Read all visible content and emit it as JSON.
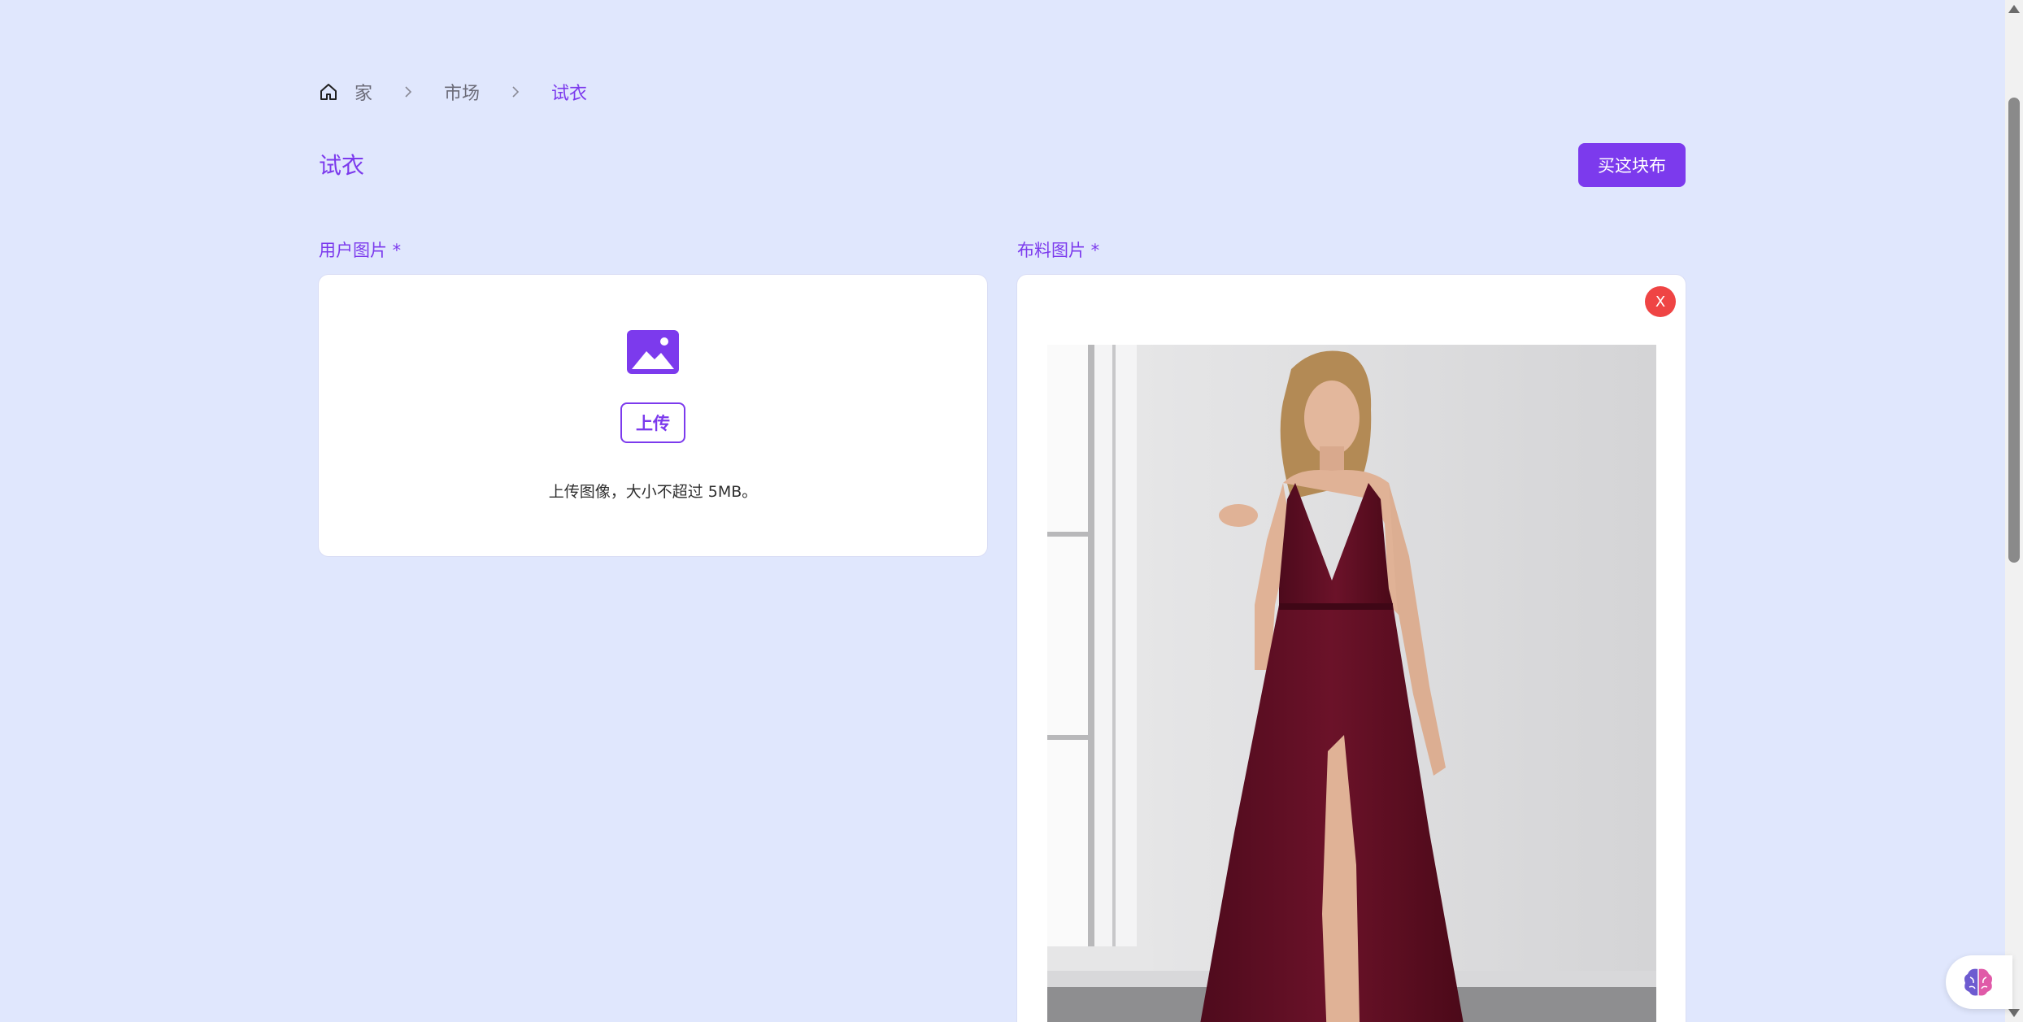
{
  "breadcrumb": {
    "home_icon": "home-icon",
    "items": [
      "家",
      "市场",
      "试衣"
    ]
  },
  "page": {
    "title": "试衣",
    "buy_button_label": "买这块布"
  },
  "user_image": {
    "label": "用户图片 *",
    "icon": "image-icon",
    "upload_label": "上传",
    "hint": "上传图像，大小不超过 5MB。"
  },
  "fabric_image": {
    "label": "布料图片 *",
    "close_label": "X",
    "image": "photo of model wearing burgundy v-neck evening gown"
  },
  "colors": {
    "accent": "#7c3aed",
    "background": "#e0e7fd",
    "danger": "#ef4444",
    "dress": "#6b1229"
  },
  "assistant": {
    "icon": "brain-icon"
  }
}
